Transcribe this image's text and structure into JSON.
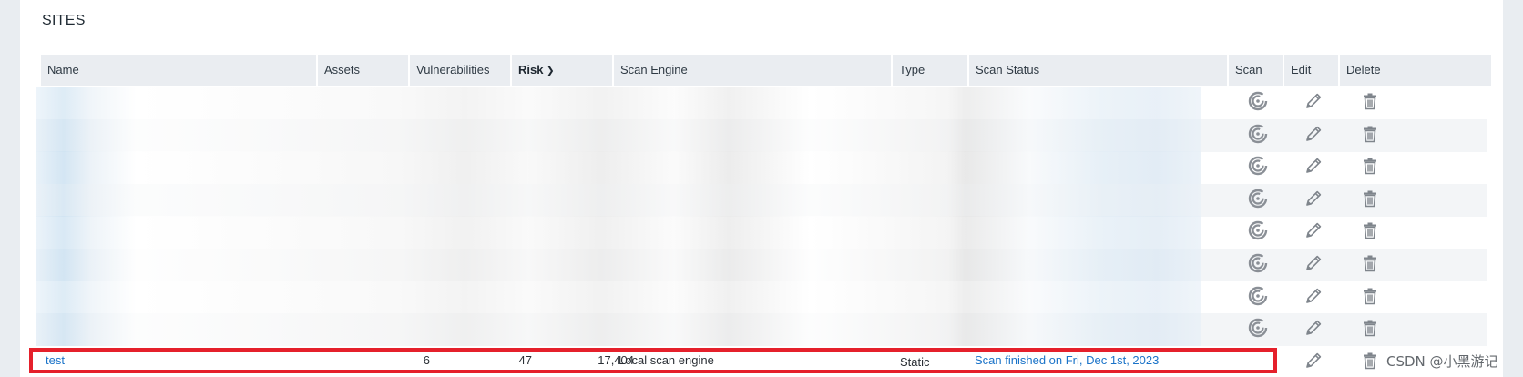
{
  "panel": {
    "title": "SITES"
  },
  "table": {
    "headers": {
      "name": "Name",
      "assets": "Assets",
      "vulnerabilities": "Vulnerabilities",
      "risk": "Risk",
      "scan_engine": "Scan Engine",
      "type": "Type",
      "scan_status": "Scan Status",
      "scan": "Scan",
      "edit": "Edit",
      "delete": "Delete"
    },
    "sorted_column": "risk",
    "sort_direction": "descending",
    "redacted_row_count": 8,
    "row_icons": {
      "scan": "scan-icon",
      "edit": "pencil-icon",
      "delete": "trash-icon"
    },
    "highlighted_row": {
      "name": "test",
      "assets": "6",
      "vulnerabilities": "47",
      "risk": "17,404",
      "scan_engine": "Local scan engine",
      "type": "Static",
      "scan_status": "Scan finished on Fri, Dec 1st, 2023"
    }
  },
  "colors": {
    "link": "#1a73c8",
    "highlight_border": "#e5202b",
    "header_bg": "#eaedf1"
  },
  "watermark": "CSDN @小黑游记"
}
